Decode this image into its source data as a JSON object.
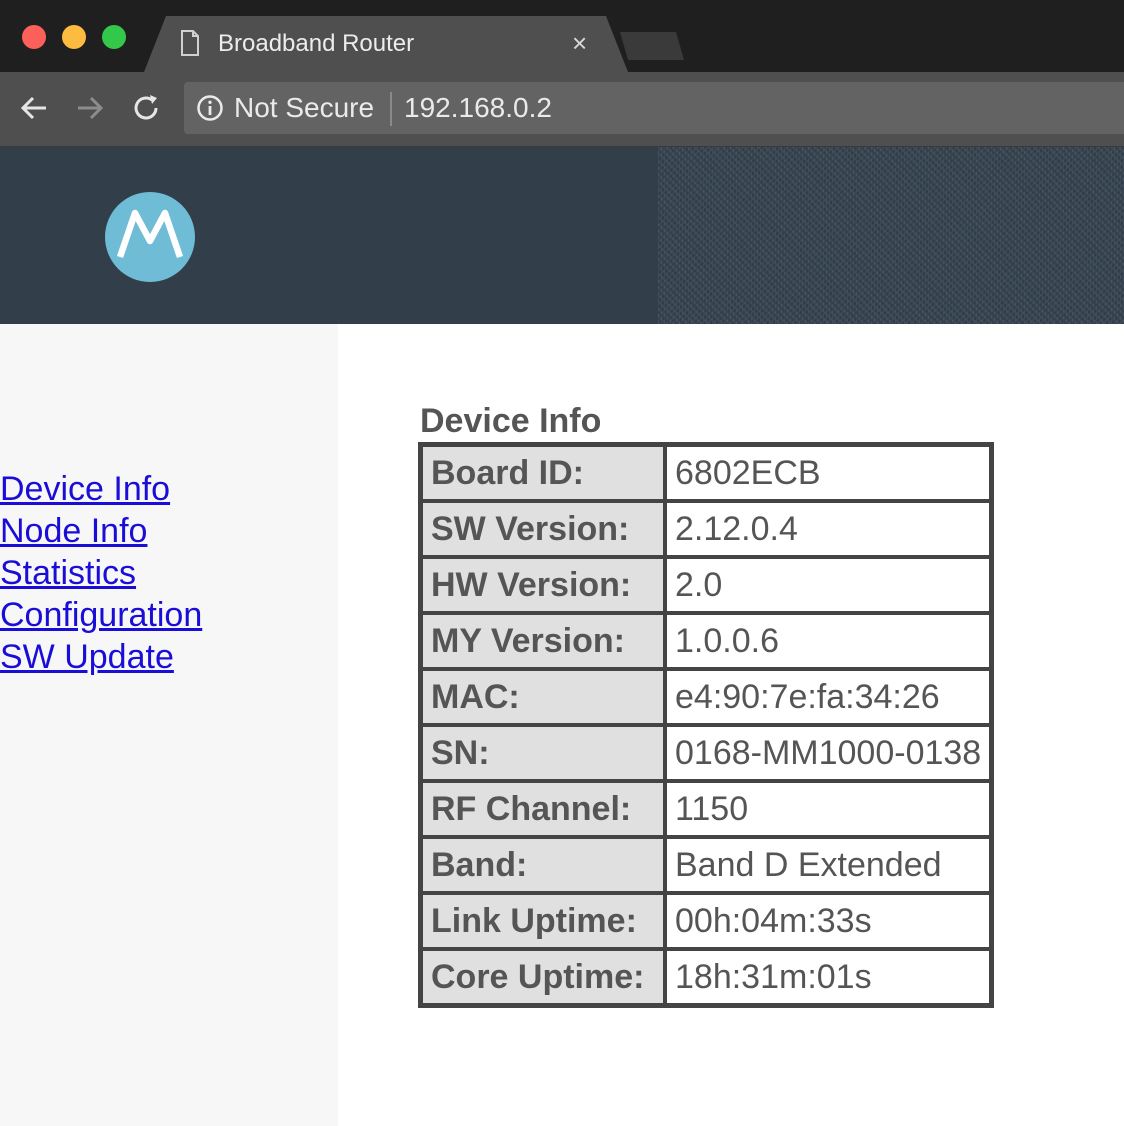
{
  "browser": {
    "tab_title": "Broadband Router",
    "tab_close": "×",
    "security_label": "Not Secure",
    "url": "192.168.0.2"
  },
  "sidebar": {
    "links": [
      {
        "label": "Device Info"
      },
      {
        "label": "Node Info"
      },
      {
        "label": "Statistics"
      },
      {
        "label": "Configuration"
      },
      {
        "label": "SW Update"
      }
    ]
  },
  "main": {
    "title": "Device Info",
    "rows": [
      {
        "label": "Board ID:",
        "value": "6802ECB"
      },
      {
        "label": "SW Version:",
        "value": "2.12.0.4"
      },
      {
        "label": "HW Version:",
        "value": "2.0"
      },
      {
        "label": "MY Version:",
        "value": "1.0.0.6"
      },
      {
        "label": "MAC:",
        "value": "e4:90:7e:fa:34:26"
      },
      {
        "label": "SN:",
        "value": "0168-MM1000-0138"
      },
      {
        "label": "RF Channel:",
        "value": "1150"
      },
      {
        "label": "Band:",
        "value": "Band D Extended"
      },
      {
        "label": "Link Uptime:",
        "value": "00h:04m:33s"
      },
      {
        "label": "Core Uptime:",
        "value": "18h:31m:01s"
      }
    ]
  },
  "colors": {
    "banner": "#323e49",
    "logo": "#6fbcd6",
    "link": "#1a0dd8",
    "label_bg": "#e0e0e0"
  },
  "icons": [
    "document-icon",
    "back-arrow-icon",
    "forward-arrow-icon",
    "reload-icon",
    "info-icon",
    "motorola-logo"
  ]
}
